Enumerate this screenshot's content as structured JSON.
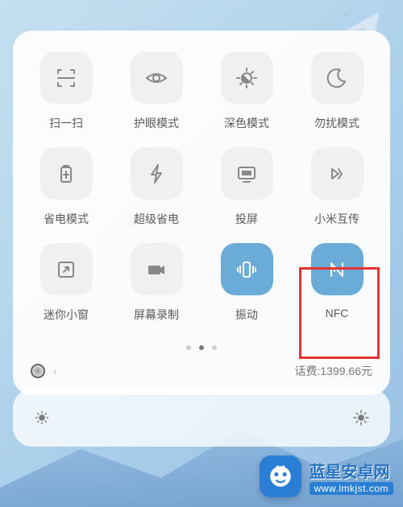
{
  "tiles": [
    {
      "id": "scan",
      "label": "扫一扫",
      "active": false
    },
    {
      "id": "eyecare",
      "label": "护眼模式",
      "active": false
    },
    {
      "id": "darkmode",
      "label": "深色模式",
      "active": false
    },
    {
      "id": "dnd",
      "label": "勿扰模式",
      "active": false
    },
    {
      "id": "battery-saver",
      "label": "省电模式",
      "active": false
    },
    {
      "id": "ultra-saver",
      "label": "超级省电",
      "active": false
    },
    {
      "id": "cast",
      "label": "投屏",
      "active": false
    },
    {
      "id": "mi-share",
      "label": "小米互传",
      "active": false
    },
    {
      "id": "mini-window",
      "label": "迷你小窗",
      "active": false
    },
    {
      "id": "screen-record",
      "label": "屏幕录制",
      "active": false
    },
    {
      "id": "vibrate",
      "label": "振动",
      "active": true
    },
    {
      "id": "nfc",
      "label": "NFC",
      "active": true
    }
  ],
  "pagination": {
    "total": 3,
    "current": 1
  },
  "status": {
    "chevron": "‹",
    "balance_label": "话费:1399.66元"
  },
  "watermark": {
    "title": "蓝星安卓网",
    "url": "www.lmkjst.com"
  },
  "highlighted_tile": "nfc"
}
